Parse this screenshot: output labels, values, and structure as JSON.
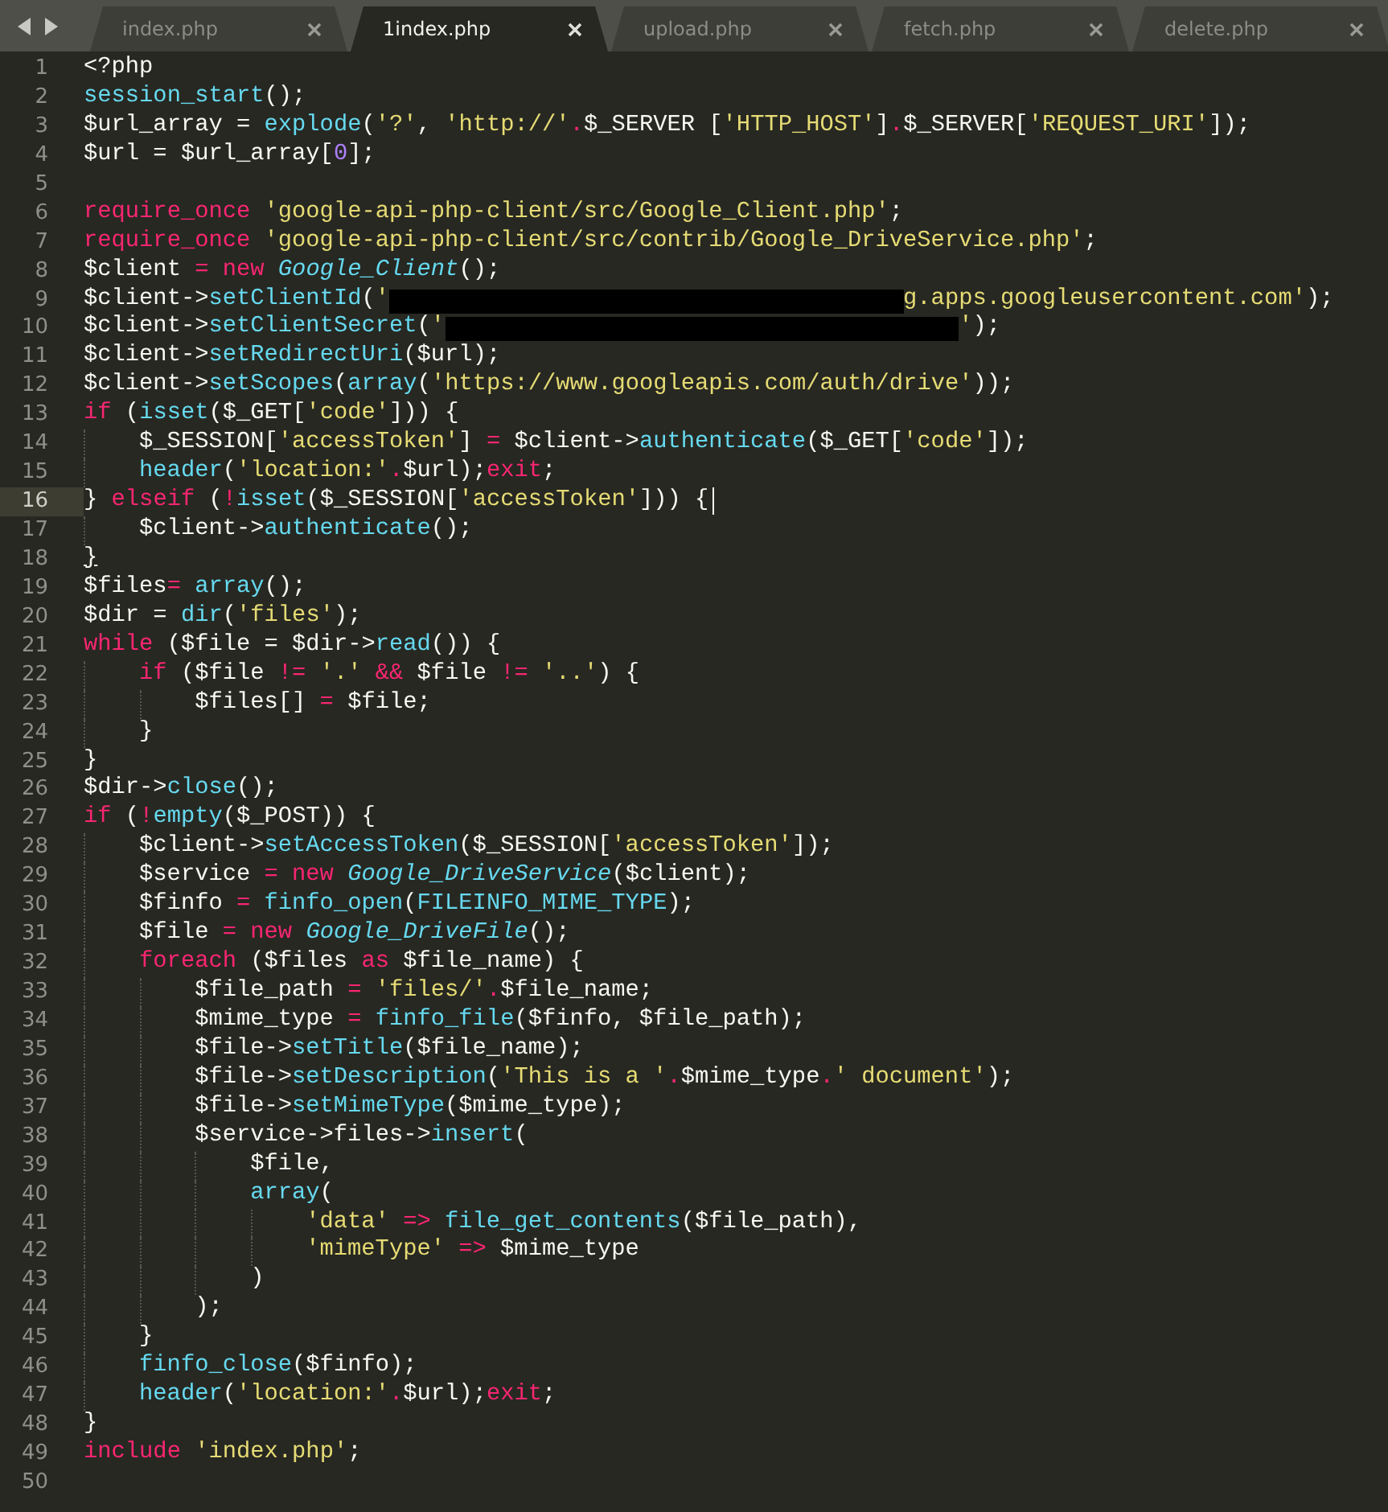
{
  "tabs": [
    {
      "label": "index.php",
      "selected": false
    },
    {
      "label": "1index.php",
      "selected": true
    },
    {
      "label": "upload.php",
      "selected": false
    },
    {
      "label": "fetch.php",
      "selected": false
    },
    {
      "label": "delete.php",
      "selected": false
    }
  ],
  "editor": {
    "lines": [
      {
        "number": "1",
        "tokens": [
          {
            "kind": "plain",
            "text": "<?php"
          }
        ]
      },
      {
        "number": "2",
        "tokens": [
          {
            "kind": "function",
            "text": "session_start"
          },
          {
            "kind": "plain",
            "text": "();"
          }
        ]
      },
      {
        "number": "3",
        "tokens": [
          {
            "kind": "plain",
            "text": "$url_array = "
          },
          {
            "kind": "function",
            "text": "explode"
          },
          {
            "kind": "plain",
            "text": "("
          },
          {
            "kind": "string",
            "text": "'?'"
          },
          {
            "kind": "plain",
            "text": ", "
          },
          {
            "kind": "string",
            "text": "'http://'"
          },
          {
            "kind": "keyword",
            "text": "."
          },
          {
            "kind": "plain",
            "text": "$_SERVER ["
          },
          {
            "kind": "string",
            "text": "'HTTP_HOST'"
          },
          {
            "kind": "plain",
            "text": "]"
          },
          {
            "kind": "keyword",
            "text": "."
          },
          {
            "kind": "plain",
            "text": "$_SERVER["
          },
          {
            "kind": "string",
            "text": "'REQUEST_URI'"
          },
          {
            "kind": "plain",
            "text": "]);"
          }
        ]
      },
      {
        "number": "4",
        "tokens": [
          {
            "kind": "plain",
            "text": "$url = $url_array["
          },
          {
            "kind": "number",
            "text": "0"
          },
          {
            "kind": "plain",
            "text": "];"
          }
        ]
      },
      {
        "number": "5"
      },
      {
        "number": "6",
        "tokens": [
          {
            "kind": "keyword",
            "text": "require_once "
          },
          {
            "kind": "string",
            "text": "'google-api-php-client/src/Google_Client.php'"
          },
          {
            "kind": "plain",
            "text": ";"
          }
        ]
      },
      {
        "number": "7",
        "tokens": [
          {
            "kind": "keyword",
            "text": "require_once "
          },
          {
            "kind": "string",
            "text": "'google-api-php-client/src/contrib/Google_DriveService.php'"
          },
          {
            "kind": "plain",
            "text": ";"
          }
        ]
      },
      {
        "number": "8",
        "tokens": [
          {
            "kind": "plain",
            "text": "$client "
          },
          {
            "kind": "keyword",
            "text": "= new "
          },
          {
            "kind": "class",
            "text": "Google_Client"
          },
          {
            "kind": "plain",
            "text": "();"
          }
        ]
      },
      {
        "number": "9",
        "tokens": [
          {
            "kind": "plain",
            "text": "$client->"
          },
          {
            "kind": "function",
            "text": "setClientId"
          },
          {
            "kind": "plain",
            "text": "("
          },
          {
            "kind": "string",
            "text": "'"
          },
          {
            "kind": "redacted"
          },
          {
            "kind": "string",
            "text": "g.apps.googleusercontent.com'"
          },
          {
            "kind": "plain",
            "text": ");"
          }
        ]
      },
      {
        "number": "10",
        "tokens": [
          {
            "kind": "plain",
            "text": "$client->"
          },
          {
            "kind": "function",
            "text": "setClientSecret"
          },
          {
            "kind": "plain",
            "text": "("
          },
          {
            "kind": "string",
            "text": "'"
          },
          {
            "kind": "redacted"
          },
          {
            "kind": "string",
            "text": "'"
          },
          {
            "kind": "plain",
            "text": ");"
          }
        ]
      },
      {
        "number": "11",
        "tokens": [
          {
            "kind": "plain",
            "text": "$client->"
          },
          {
            "kind": "function",
            "text": "setRedirectUri"
          },
          {
            "kind": "plain",
            "text": "($url);"
          }
        ]
      },
      {
        "number": "12",
        "tokens": [
          {
            "kind": "plain",
            "text": "$client->"
          },
          {
            "kind": "function",
            "text": "setScopes"
          },
          {
            "kind": "plain",
            "text": "("
          },
          {
            "kind": "function",
            "text": "array"
          },
          {
            "kind": "plain",
            "text": "("
          },
          {
            "kind": "string",
            "text": "'https://www.googleapis.com/auth/drive'"
          },
          {
            "kind": "plain",
            "text": "));"
          }
        ]
      },
      {
        "number": "13",
        "tokens": [
          {
            "kind": "keyword",
            "text": "if"
          },
          {
            "kind": "plain",
            "text": " ("
          },
          {
            "kind": "function",
            "text": "isset"
          },
          {
            "kind": "plain",
            "text": "($_GET["
          },
          {
            "kind": "string",
            "text": "'code'"
          },
          {
            "kind": "plain",
            "text": "])) {"
          }
        ]
      },
      {
        "number": "14",
        "tokens": [
          {
            "kind": "plain",
            "text": "    $_SESSION["
          },
          {
            "kind": "string",
            "text": "'accessToken'"
          },
          {
            "kind": "plain",
            "text": "] "
          },
          {
            "kind": "keyword",
            "text": "="
          },
          {
            "kind": "plain",
            "text": " $client->"
          },
          {
            "kind": "function",
            "text": "authenticate"
          },
          {
            "kind": "plain",
            "text": "($_GET["
          },
          {
            "kind": "string",
            "text": "'code'"
          },
          {
            "kind": "plain",
            "text": "]);"
          }
        ]
      },
      {
        "number": "15",
        "tokens": [
          {
            "kind": "function",
            "text": "    header"
          },
          {
            "kind": "plain",
            "text": "("
          },
          {
            "kind": "string",
            "text": "'location:'"
          },
          {
            "kind": "keyword",
            "text": "."
          },
          {
            "kind": "plain",
            "text": "$url);"
          },
          {
            "kind": "keyword",
            "text": "exit"
          },
          {
            "kind": "plain",
            "text": ";"
          }
        ]
      },
      {
        "number": "16",
        "current": true,
        "cursor": true,
        "tokens": [
          {
            "kind": "plain",
            "text": "} "
          },
          {
            "kind": "keyword",
            "text": "elseif"
          },
          {
            "kind": "plain",
            "text": " ("
          },
          {
            "kind": "keyword",
            "text": "!"
          },
          {
            "kind": "function",
            "text": "isset"
          },
          {
            "kind": "plain",
            "text": "($_SESSION["
          },
          {
            "kind": "string",
            "text": "'accessToken'"
          },
          {
            "kind": "plain",
            "text": "])) {"
          }
        ]
      },
      {
        "number": "17",
        "tokens": [
          {
            "kind": "plain",
            "text": "    $client->"
          },
          {
            "kind": "function",
            "text": "authenticate"
          },
          {
            "kind": "plain",
            "text": "();"
          }
        ]
      },
      {
        "number": "18",
        "tokens": [
          {
            "kind": "match",
            "text": "}"
          }
        ]
      },
      {
        "number": "19",
        "tokens": [
          {
            "kind": "plain",
            "text": "$files"
          },
          {
            "kind": "keyword",
            "text": "= "
          },
          {
            "kind": "function",
            "text": "array"
          },
          {
            "kind": "plain",
            "text": "();"
          }
        ]
      },
      {
        "number": "20",
        "tokens": [
          {
            "kind": "plain",
            "text": "$dir = "
          },
          {
            "kind": "function",
            "text": "dir"
          },
          {
            "kind": "plain",
            "text": "("
          },
          {
            "kind": "string",
            "text": "'files'"
          },
          {
            "kind": "plain",
            "text": ");"
          }
        ]
      },
      {
        "number": "21",
        "tokens": [
          {
            "kind": "keyword",
            "text": "while"
          },
          {
            "kind": "plain",
            "text": " ($file = $dir->"
          },
          {
            "kind": "function",
            "text": "read"
          },
          {
            "kind": "plain",
            "text": "()) {"
          }
        ]
      },
      {
        "number": "22",
        "tokens": [
          {
            "kind": "keyword",
            "text": "    if"
          },
          {
            "kind": "plain",
            "text": " ($file "
          },
          {
            "kind": "keyword",
            "text": "!= "
          },
          {
            "kind": "string",
            "text": "'.' "
          },
          {
            "kind": "keyword",
            "text": "&&"
          },
          {
            "kind": "plain",
            "text": " $file "
          },
          {
            "kind": "keyword",
            "text": "!= "
          },
          {
            "kind": "string",
            "text": "'..'"
          },
          {
            "kind": "plain",
            "text": ") {"
          }
        ]
      },
      {
        "number": "23",
        "tokens": [
          {
            "kind": "plain",
            "text": "        $files[] "
          },
          {
            "kind": "keyword",
            "text": "="
          },
          {
            "kind": "plain",
            "text": " $file;"
          }
        ]
      },
      {
        "number": "24",
        "tokens": [
          {
            "kind": "plain",
            "text": "    }"
          }
        ]
      },
      {
        "number": "25",
        "tokens": [
          {
            "kind": "plain",
            "text": "}"
          }
        ]
      },
      {
        "number": "26",
        "tokens": [
          {
            "kind": "plain",
            "text": "$dir->"
          },
          {
            "kind": "function",
            "text": "close"
          },
          {
            "kind": "plain",
            "text": "();"
          }
        ]
      },
      {
        "number": "27",
        "tokens": [
          {
            "kind": "keyword",
            "text": "if"
          },
          {
            "kind": "plain",
            "text": " ("
          },
          {
            "kind": "keyword",
            "text": "!"
          },
          {
            "kind": "function",
            "text": "empty"
          },
          {
            "kind": "plain",
            "text": "($_POST)) {"
          }
        ]
      },
      {
        "number": "28",
        "tokens": [
          {
            "kind": "plain",
            "text": "    $client->"
          },
          {
            "kind": "function",
            "text": "setAccessToken"
          },
          {
            "kind": "plain",
            "text": "($_SESSION["
          },
          {
            "kind": "string",
            "text": "'accessToken'"
          },
          {
            "kind": "plain",
            "text": "]);"
          }
        ]
      },
      {
        "number": "29",
        "tokens": [
          {
            "kind": "plain",
            "text": "    $service "
          },
          {
            "kind": "keyword",
            "text": "= new "
          },
          {
            "kind": "class",
            "text": "Google_DriveService"
          },
          {
            "kind": "plain",
            "text": "($client);"
          }
        ]
      },
      {
        "number": "30",
        "tokens": [
          {
            "kind": "plain",
            "text": "    $finfo "
          },
          {
            "kind": "keyword",
            "text": "= "
          },
          {
            "kind": "function",
            "text": "finfo_open"
          },
          {
            "kind": "plain",
            "text": "("
          },
          {
            "kind": "function",
            "text": "FILEINFO_MIME_TYPE"
          },
          {
            "kind": "plain",
            "text": ");"
          }
        ]
      },
      {
        "number": "31",
        "tokens": [
          {
            "kind": "plain",
            "text": "    $file "
          },
          {
            "kind": "keyword",
            "text": "= new "
          },
          {
            "kind": "class",
            "text": "Google_DriveFile"
          },
          {
            "kind": "plain",
            "text": "();"
          }
        ]
      },
      {
        "number": "32",
        "tokens": [
          {
            "kind": "keyword",
            "text": "    foreach"
          },
          {
            "kind": "plain",
            "text": " ($files "
          },
          {
            "kind": "keyword",
            "text": "as"
          },
          {
            "kind": "plain",
            "text": " $file_name) {"
          }
        ]
      },
      {
        "number": "33",
        "tokens": [
          {
            "kind": "plain",
            "text": "        $file_path "
          },
          {
            "kind": "keyword",
            "text": "= "
          },
          {
            "kind": "string",
            "text": "'files/'"
          },
          {
            "kind": "keyword",
            "text": "."
          },
          {
            "kind": "plain",
            "text": "$file_name;"
          }
        ]
      },
      {
        "number": "34",
        "tokens": [
          {
            "kind": "plain",
            "text": "        $mime_type "
          },
          {
            "kind": "keyword",
            "text": "= "
          },
          {
            "kind": "function",
            "text": "finfo_file"
          },
          {
            "kind": "plain",
            "text": "($finfo, $file_path);"
          }
        ]
      },
      {
        "number": "35",
        "tokens": [
          {
            "kind": "plain",
            "text": "        $file->"
          },
          {
            "kind": "function",
            "text": "setTitle"
          },
          {
            "kind": "plain",
            "text": "($file_name);"
          }
        ]
      },
      {
        "number": "36",
        "tokens": [
          {
            "kind": "plain",
            "text": "        $file->"
          },
          {
            "kind": "function",
            "text": "setDescription"
          },
          {
            "kind": "plain",
            "text": "("
          },
          {
            "kind": "string",
            "text": "'This is a '"
          },
          {
            "kind": "keyword",
            "text": "."
          },
          {
            "kind": "plain",
            "text": "$mime_type"
          },
          {
            "kind": "keyword",
            "text": "."
          },
          {
            "kind": "string",
            "text": "' document'"
          },
          {
            "kind": "plain",
            "text": ");"
          }
        ]
      },
      {
        "number": "37",
        "tokens": [
          {
            "kind": "plain",
            "text": "        $file->"
          },
          {
            "kind": "function",
            "text": "setMimeType"
          },
          {
            "kind": "plain",
            "text": "($mime_type);"
          }
        ]
      },
      {
        "number": "38",
        "tokens": [
          {
            "kind": "plain",
            "text": "        $service->files->"
          },
          {
            "kind": "function",
            "text": "insert"
          },
          {
            "kind": "plain",
            "text": "("
          }
        ]
      },
      {
        "number": "39",
        "tokens": [
          {
            "kind": "plain",
            "text": "            $file,"
          }
        ]
      },
      {
        "number": "40",
        "tokens": [
          {
            "kind": "function",
            "text": "            array"
          },
          {
            "kind": "plain",
            "text": "("
          }
        ]
      },
      {
        "number": "41",
        "tokens": [
          {
            "kind": "string",
            "text": "                'data' "
          },
          {
            "kind": "keyword",
            "text": "=> "
          },
          {
            "kind": "function",
            "text": "file_get_contents"
          },
          {
            "kind": "plain",
            "text": "($file_path),"
          }
        ]
      },
      {
        "number": "42",
        "tokens": [
          {
            "kind": "string",
            "text": "                'mimeType' "
          },
          {
            "kind": "keyword",
            "text": "=>"
          },
          {
            "kind": "plain",
            "text": " $mime_type"
          }
        ]
      },
      {
        "number": "43",
        "tokens": [
          {
            "kind": "plain",
            "text": "            )"
          }
        ]
      },
      {
        "number": "44",
        "tokens": [
          {
            "kind": "plain",
            "text": "        );"
          }
        ]
      },
      {
        "number": "45",
        "tokens": [
          {
            "kind": "plain",
            "text": "    }"
          }
        ]
      },
      {
        "number": "46",
        "tokens": [
          {
            "kind": "function",
            "text": "    finfo_close"
          },
          {
            "kind": "plain",
            "text": "($finfo);"
          }
        ]
      },
      {
        "number": "47",
        "tokens": [
          {
            "kind": "function",
            "text": "    header"
          },
          {
            "kind": "plain",
            "text": "("
          },
          {
            "kind": "string",
            "text": "'location:'"
          },
          {
            "kind": "keyword",
            "text": "."
          },
          {
            "kind": "plain",
            "text": "$url);"
          },
          {
            "kind": "keyword",
            "text": "exit"
          },
          {
            "kind": "plain",
            "text": ";"
          }
        ]
      },
      {
        "number": "48",
        "tokens": [
          {
            "kind": "plain",
            "text": "}"
          }
        ]
      },
      {
        "number": "49",
        "tokens": [
          {
            "kind": "keyword",
            "text": "include "
          },
          {
            "kind": "string",
            "text": "'index.php'"
          },
          {
            "kind": "plain",
            "text": ";"
          }
        ]
      },
      {
        "number": "50"
      }
    ]
  }
}
